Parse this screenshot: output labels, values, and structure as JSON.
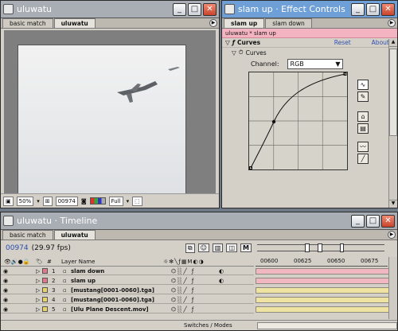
{
  "comp_window": {
    "title": "uluwatu",
    "tabs": [
      "basic match",
      "uluwatu"
    ],
    "zoom": "50%",
    "timecode": "00974",
    "resolution": "Full"
  },
  "effect_controls": {
    "title": "slam up · Effect Controls",
    "tabs": [
      "slam up",
      "slam down"
    ],
    "header": "uluwatu * slam up",
    "effect_name": "Curves",
    "reset_label": "Reset",
    "about_label": "About...",
    "param_label": "Curves",
    "channel_label": "Channel:",
    "channel_value": "RGB"
  },
  "timeline": {
    "title": "uluwatu · Timeline",
    "tabs": [
      "basic match",
      "uluwatu"
    ],
    "timecode": "00974",
    "fps": "(29.97 fps)",
    "col_num": "#",
    "col_layer": "Layer Name",
    "col_mode": "M",
    "ruler": [
      "00600",
      "00625",
      "00650",
      "00675"
    ],
    "switches_label": "Switches / Modes",
    "layers": [
      {
        "num": "1",
        "name": "slam down",
        "label_color": "#e07a8a",
        "bar_color": "#f2b8c2"
      },
      {
        "num": "2",
        "name": "slam up",
        "label_color": "#e07a8a",
        "bar_color": "#f2b8c2"
      },
      {
        "num": "3",
        "name": "[mustang[0001-0060].tga]",
        "label_color": "#e6d36a",
        "bar_color": "#efe3a2"
      },
      {
        "num": "4",
        "name": "[mustang[0001-0060].tga]",
        "label_color": "#e6d36a",
        "bar_color": "#efe3a2"
      },
      {
        "num": "5",
        "name": "[Ulu Plane Descent.mov]",
        "label_color": "#e6d36a",
        "bar_color": "#efe3a2"
      }
    ]
  }
}
